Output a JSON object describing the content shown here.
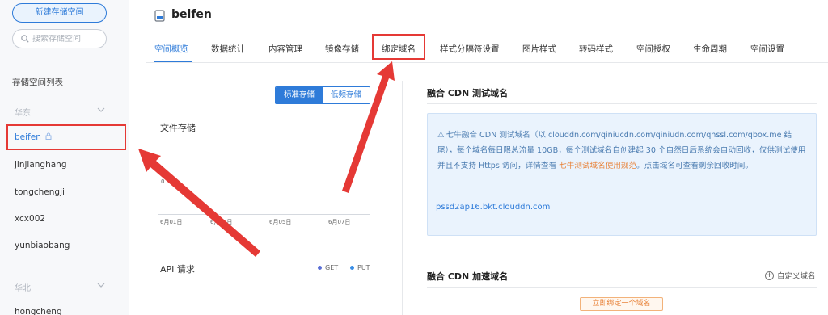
{
  "sidebar": {
    "new_bucket_label": "新建存储空间",
    "search_placeholder": "搜索存储空间",
    "list_title": "存储空间列表",
    "regions": [
      {
        "name": "华东",
        "buckets": [
          "beifen",
          "jinjianghang",
          "tongchengji",
          "xcx002",
          "yunbiaobang"
        ]
      },
      {
        "name": "华北",
        "buckets": [
          "hongcheng"
        ]
      }
    ]
  },
  "header": {
    "title": "beifen",
    "icon": "bucket-icon"
  },
  "tabs": [
    "空间概览",
    "数据统计",
    "内容管理",
    "镜像存储",
    "绑定域名",
    "样式分隔符设置",
    "图片样式",
    "转码样式",
    "空间授权",
    "生命周期",
    "空间设置"
  ],
  "storage_toggle": {
    "standard": "标准存储",
    "infrequent": "低频存储"
  },
  "file_storage": {
    "title": "文件存储",
    "chart_data": {
      "type": "line",
      "x": [
        "6月01日",
        "6月03日",
        "6月05日",
        "6月07日"
      ],
      "y_tick": "0"
    }
  },
  "api": {
    "title": "API 请求",
    "legend": [
      "GET",
      "PUT"
    ]
  },
  "cdn_test": {
    "title": "融合 CDN 测试域名",
    "notice_prefix": "七牛融合 CDN 测试域名（以 clouddn.com/qiniucdn.com/qiniudn.com/qnssl.com/qbox.me 结尾），每个域名每日限总流量 10GB，每个测试域名自创建起 30 个自然日后系统会自动回收，仅供测试使用并且不支持 Https 访问，详情查看 ",
    "notice_link": "七牛测试域名使用规范",
    "notice_suffix": "。点击域名可查看剩余回收时间。",
    "domain": "pssd2ap16.bkt.clouddn.com"
  },
  "cdn_accel": {
    "title": "融合 CDN 加速域名",
    "custom_label": "自定义域名",
    "bind_button": "立即绑定一个域名"
  },
  "colors": {
    "accent": "#2e7bd9",
    "highlight": "#e53935",
    "link_orange": "#e8833a"
  }
}
